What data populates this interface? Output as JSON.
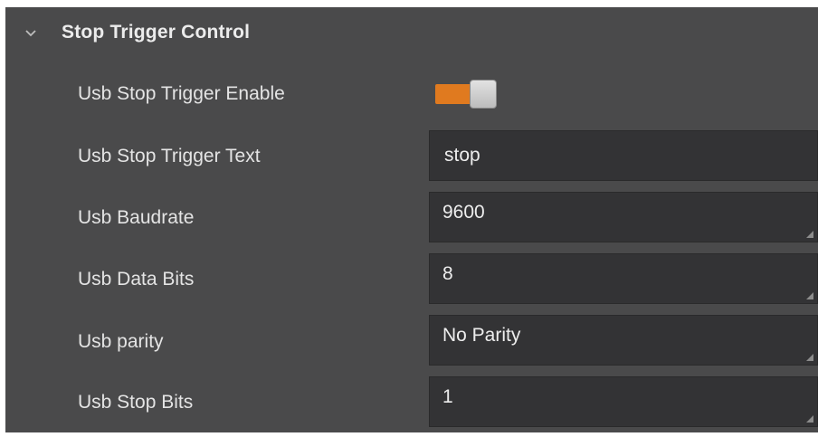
{
  "section": {
    "title": "Stop Trigger Control",
    "expanded": true
  },
  "rows": {
    "enable": {
      "label": "Usb Stop Trigger Enable",
      "on": true
    },
    "text": {
      "label": "Usb Stop Trigger Text",
      "value": "stop"
    },
    "baudrate": {
      "label": "Usb Baudrate",
      "value": "9600"
    },
    "data_bits": {
      "label": "Usb Data Bits",
      "value": "8"
    },
    "parity": {
      "label": "Usb parity",
      "value": "No Parity"
    },
    "stop_bits": {
      "label": "Usb Stop Bits",
      "value": "1"
    }
  },
  "colors": {
    "panel_bg": "#4a4a4b",
    "field_bg": "#333335",
    "toggle_on": "#e07a1f",
    "text": "#e4e4e4"
  },
  "icons": {
    "collapse": "chevron-down-icon",
    "resize": "resize-grip-icon"
  }
}
